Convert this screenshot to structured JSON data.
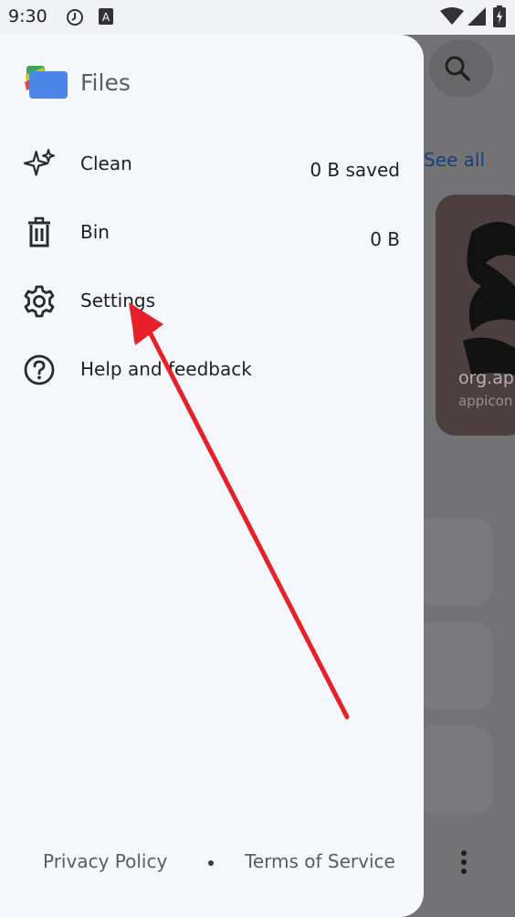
{
  "status_bar": {
    "time": "9:30",
    "icons": [
      "sync-icon",
      "text-a-icon",
      "wifi-icon",
      "signal-icon",
      "battery-icon"
    ]
  },
  "drawer": {
    "app_title": "Files",
    "items": [
      {
        "label": "Clean",
        "value": "0 B saved",
        "icon": "sparkle-icon"
      },
      {
        "label": "Bin",
        "value": "0 B",
        "icon": "trash-icon"
      },
      {
        "label": "Settings",
        "icon": "gear-icon"
      },
      {
        "label": "Help and feedback",
        "icon": "help-icon"
      }
    ],
    "footer": {
      "privacy": "Privacy Policy",
      "terms": "Terms of Service"
    }
  },
  "background": {
    "see_all": "See all",
    "card_title": "org.ap",
    "card_subtitle": "appicon"
  },
  "colors": {
    "drawer_bg": "#f7f8fd",
    "scrim": "#6e6e70",
    "annotation_arrow": "#e8202a",
    "logo_blue": "#4a86e8",
    "logo_green": "#3aa757",
    "logo_yellow": "#f5b800",
    "logo_red": "#e8453c"
  }
}
